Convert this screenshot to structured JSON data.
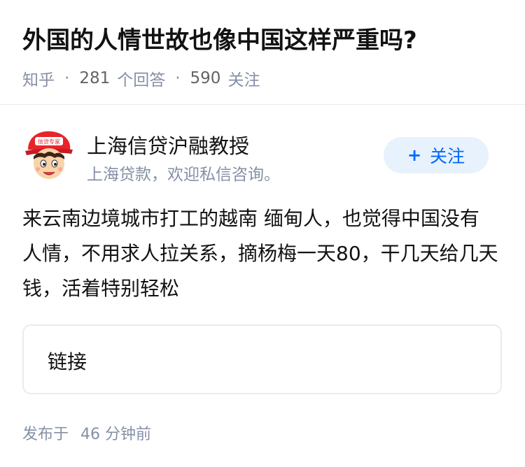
{
  "question": {
    "title": "外国的人情世故也像中国这样严重吗?",
    "source": "知乎",
    "answer_count": "281",
    "answer_label": "个回答",
    "follower_count": "590",
    "follower_label": "关注"
  },
  "author": {
    "name": "上海信贷沪融教授",
    "bio": "上海贷款，欢迎私信咨询。",
    "avatar_icon": "cartoon-avatar",
    "avatar_badge_text": "信贷专家"
  },
  "follow_button": {
    "plus": "+",
    "label": "关注",
    "color": "#0066ff",
    "background": "#e8f2fc"
  },
  "answer": {
    "text": "来云南边境城市打工的越南 缅甸人，也觉得中国没有人情，不用求人拉关系，摘杨梅一天80，干几天给几天钱，活着特别轻松"
  },
  "link_card": {
    "label": "链接"
  },
  "meta": {
    "publish_prefix": "发布于",
    "publish_time": "46 分钟前"
  }
}
